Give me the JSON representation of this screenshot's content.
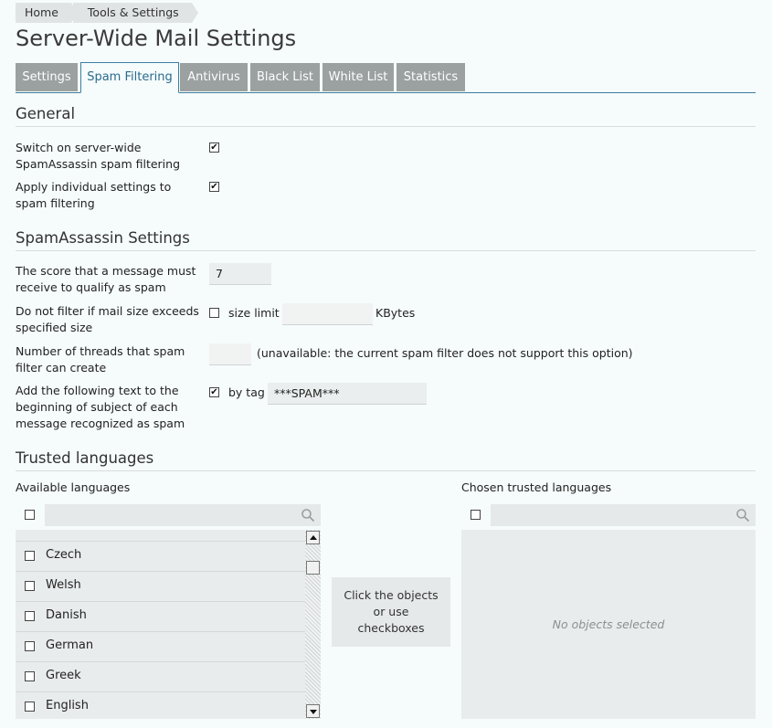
{
  "breadcrumb": [
    "Home",
    "Tools & Settings"
  ],
  "page_title": "Server-Wide Mail Settings",
  "tabs": [
    {
      "label": "Settings",
      "active": false
    },
    {
      "label": "Spam Filtering",
      "active": true
    },
    {
      "label": "Antivirus",
      "active": false
    },
    {
      "label": "Black List",
      "active": false
    },
    {
      "label": "White List",
      "active": false
    },
    {
      "label": "Statistics",
      "active": false
    }
  ],
  "general": {
    "heading": "General",
    "switch_on_label": "Switch on server-wide SpamAssassin spam filtering",
    "switch_on_checked": true,
    "apply_individual_label": "Apply individual settings to spam filtering",
    "apply_individual_checked": true
  },
  "spamassassin": {
    "heading": "SpamAssassin Settings",
    "score_label": "The score that a message must receive to qualify as spam",
    "score_value": "7",
    "size_label": "Do not filter if mail size exceeds specified size",
    "size_checked": false,
    "size_limit_text": "size limit",
    "size_limit_value": "",
    "size_unit": "KBytes",
    "threads_label": "Number of threads that spam filter can create",
    "threads_value": "",
    "threads_note": "(unavailable: the current spam filter does not support this option)",
    "tag_label": "Add the following text to the beginning of subject of each message recognized as spam",
    "tag_checked": true,
    "tag_text": "by tag",
    "tag_value": "***SPAM***"
  },
  "trusted": {
    "heading": "Trusted languages",
    "available_label": "Available languages",
    "chosen_label": "Chosen trusted languages",
    "languages": [
      "Czech",
      "Welsh",
      "Danish",
      "German",
      "Greek",
      "English"
    ],
    "hint": "Click the objects or use checkboxes",
    "empty_text": "No objects selected"
  },
  "icons": {
    "search": "magnifier-icon",
    "checkbox": "checkbox-icon"
  }
}
